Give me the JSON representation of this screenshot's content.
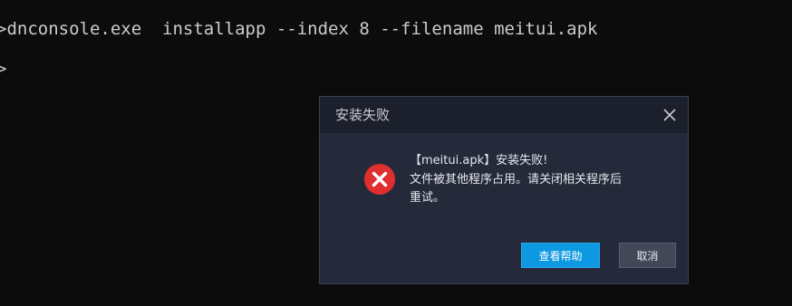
{
  "terminal": {
    "line1": ">dnconsole.exe  installapp --index 8 --filename meitui.apk",
    "line2": ">"
  },
  "dialog": {
    "title": "安装失败",
    "message_line1": "【meitui.apk】安装失败!",
    "message_line2": "文件被其他程序占用。请关闭相关程序后",
    "message_line3": "重试。",
    "help_button": "查看帮助",
    "cancel_button": "取消"
  },
  "icons": {
    "close": "close-icon",
    "error": "error-icon"
  },
  "colors": {
    "terminal_bg": "#0c0c0c",
    "terminal_text": "#cccccc",
    "dialog_bg": "#252a3a",
    "dialog_header_bg": "#1c202c",
    "error_red": "#e02f2f",
    "primary_button": "#0d98e2",
    "secondary_button": "#424858"
  }
}
